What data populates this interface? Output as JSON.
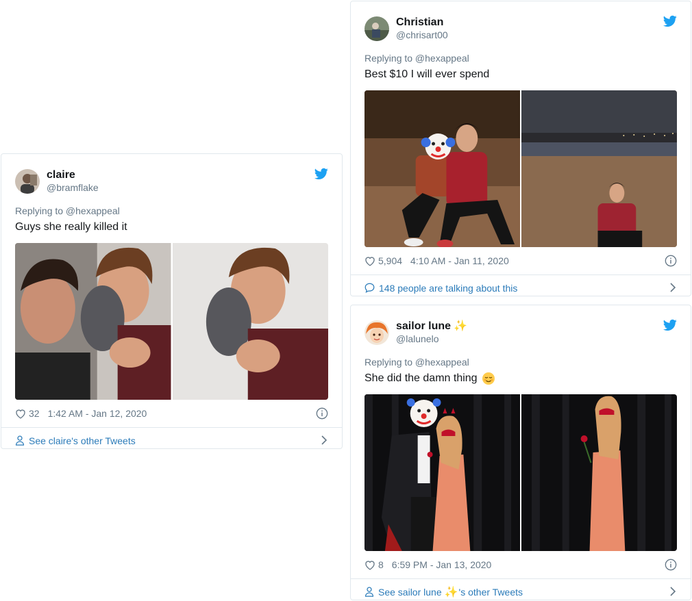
{
  "tweets": [
    {
      "display_name": "claire",
      "handle": "@bramflake",
      "replying_to": "Replying to @hexappeal",
      "text": "Guys she really killed it",
      "likes": "32",
      "timestamp": "1:42 AM - Jan 12, 2020",
      "footer": "See claire's other Tweets"
    },
    {
      "display_name": "Christian",
      "handle": "@chrisart00",
      "replying_to": "Replying to @hexappeal",
      "text": "Best $10 I will ever spend",
      "likes": "5,904",
      "timestamp": "4:10 AM - Jan 11, 2020",
      "footer": "148 people are talking about this"
    },
    {
      "display_name": "sailor lune",
      "handle": "@lalunelo",
      "replying_to": "Replying to @hexappeal",
      "text": "She did the damn thing",
      "likes": "8",
      "timestamp": "6:59 PM - Jan 13, 2020",
      "footer_prefix": "See sailor lune",
      "footer_suffix": "'s other Tweets"
    }
  ],
  "colors": {
    "twitter_blue": "#1da1f2",
    "link_blue": "#2b7bb9",
    "muted_gray": "#657786",
    "border": "#e1e8ed"
  },
  "icons": [
    "twitter-bird-icon",
    "heart-icon",
    "info-icon",
    "person-icon",
    "comment-icon",
    "chevron-right-icon",
    "sparkle-emoji",
    "relieved-face-emoji",
    "clown-face-emoji"
  ]
}
